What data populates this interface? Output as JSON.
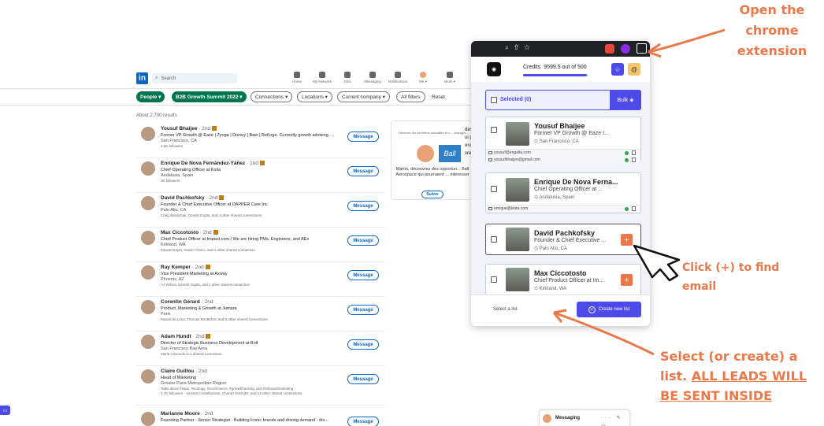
{
  "linkedin": {
    "logo": "in",
    "search_placeholder": "Search",
    "nav": [
      {
        "label": "Home",
        "icon": "home-icon"
      },
      {
        "label": "My Network",
        "icon": "network-icon"
      },
      {
        "label": "Jobs",
        "icon": "jobs-icon"
      },
      {
        "label": "Messaging",
        "icon": "messaging-icon"
      },
      {
        "label": "Notifications",
        "icon": "bell-icon"
      },
      {
        "label": "Me ▾",
        "icon": "avatar"
      },
      {
        "label": "Work ▾",
        "icon": "grid-icon"
      }
    ],
    "filters": {
      "people": "People ▾",
      "summit": "B2B Growth Summit 2022 ▾",
      "connections": "Connections ▾",
      "locations": "Locations ▾",
      "company": "Current company ▾",
      "all_filters": "All filters",
      "reset": "Reset"
    },
    "results_count": "About 2,700 results",
    "message_label": "Message",
    "results": [
      {
        "name": "Yousuf Bhaijee",
        "degree": " · 2nd",
        "headline": "Former VP Growth @ Eaze | Zynga | Disney | Bain | Reforge. Currently growth advising, ...",
        "location": "San Francisco, CA",
        "extra": "4.3K followers"
      },
      {
        "name": "Enrique De Nova Fernández-Yáñez",
        "degree": " · 2nd",
        "headline": "Chief Operating Officer at Kiota",
        "location": "Andalusia, Spain",
        "extra": "3K followers"
      },
      {
        "name": "David Pachkofsky",
        "degree": " · 2nd",
        "headline": "Founder & Chief Executive Officer at DAPPER Care Inc.",
        "location": "Palo Alto, CA",
        "extra": "Craig Waslichak, Dinesh Gupta, and 4 other shared connections"
      },
      {
        "name": "Max Ciccotosto",
        "degree": " · 2nd",
        "headline": "Chief Product Officer at Impact.com / We are hiring PMs, Engineers, and AEs",
        "location": "Kirkland, WA",
        "extra": "Pascal Gayet, Xavier Ferero, and 1 other shared connection"
      },
      {
        "name": "Ray Kemper",
        "degree": " · 2nd",
        "headline": "Vice President Marketing at Axway",
        "location": "Phoenix, AZ",
        "extra": "AJ Wilcox, Dinesh Gupta, and 1 other shared connection"
      },
      {
        "name": "Corentin Gérard",
        "degree": " · 2nd",
        "headline": "Product, Marketing & Growth at Jumara",
        "location": "Paris",
        "extra": "Pascal de Lima, Thomas Bouttefort, and 8 other shared connections"
      },
      {
        "name": "Adam Hundt",
        "degree": " · 2nd",
        "headline": "Director of Strategic Business Development at Bolt",
        "location": "San Francisco Bay Area",
        "extra": "Marie Criscuolo is a shared connection"
      },
      {
        "name": "Claire Guillou",
        "degree": " · 2nd",
        "headline": "Head of Marketing",
        "location": "Greater Paris Metropolitan Region",
        "extra": "Talks about #saas, #ecology, #ecommerce, #growthhacking, and #inboundmarketing",
        "extra2": "1.7K followers · Vincent Costellazione, Chanez DJOUDI, and 13 other shared connections"
      },
      {
        "name": "Marianne Moore",
        "degree": " · 2nd",
        "headline": "Founding Partner - Senior Strategist - Building iconic brands and driving demand - dis...",
        "location": "",
        "extra": ""
      }
    ],
    "ad": {
      "top_text": "Recevez les dernières actualités et o... chang(e)",
      "logo": "Ball",
      "body": "Martin, découvrez des opportun... Ball Aerospace qui pourraient ... intéresser",
      "button": "Suivre"
    },
    "bg_strip": [
      "des",
      "ui p",
      "esse",
      "vre"
    ],
    "messaging_label": "Messaging",
    "messaging_controls": "··· ✎ ︿",
    "left_tab_icon": "video-icon"
  },
  "extension": {
    "credits_label": "Credits",
    "credits_value": "9599.5 out of 500",
    "credits_progress": 0.98,
    "selected_label": "Selected (0)",
    "bulk_label": "Bulk",
    "leads": [
      {
        "name": "Yousuf Bhaijee",
        "headline": "Former VP Growth @ Eaze I...",
        "location": "San Francisco, CA",
        "emails": [
          "yousuf@engalla.com",
          "yousufbhaijee@gmail.com"
        ]
      },
      {
        "name": "Enrique De Nova Ferna...",
        "headline": "Chief Operating Officer at ...",
        "location": "Andalusia, Spain",
        "emails": [
          "enrique@kiota.com"
        ]
      },
      {
        "name": "David Pachkofsky",
        "headline": "Founder & Chief Executive ...",
        "location": "Palo Alto, CA",
        "emails": [],
        "plus": "+"
      },
      {
        "name": "Max Ciccotosto",
        "headline": "Chief Product Officer at Im...",
        "location": "Kirkland, WA",
        "emails": [],
        "plus": "+"
      }
    ],
    "select_list_label": "Select a list",
    "create_list_label": "Create new list"
  },
  "annotations": {
    "open_extension": "Open the chrome extension",
    "click_plus": "Click (+) to find email",
    "select_list_1": "Select (or create) a list.",
    "select_list_2": "ALL LEADS WILL BE SENT INSIDE"
  },
  "colors": {
    "accent": "#4d4ae8",
    "annotation": "#e9794b",
    "linkedin_blue": "#0a66c2",
    "linkedin_green": "#01754f"
  }
}
